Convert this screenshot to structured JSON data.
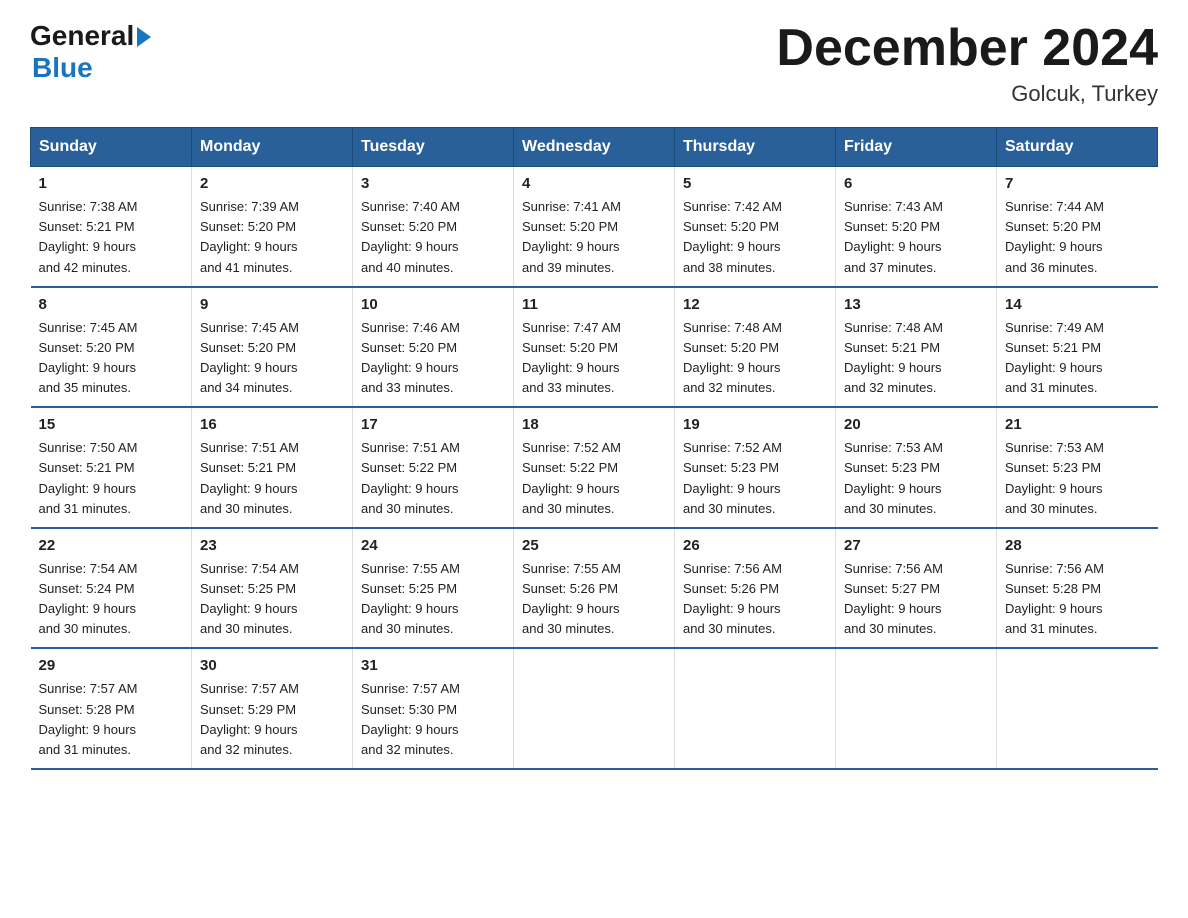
{
  "logo": {
    "general": "General",
    "blue": "Blue"
  },
  "title": "December 2024",
  "location": "Golcuk, Turkey",
  "weekdays": [
    "Sunday",
    "Monday",
    "Tuesday",
    "Wednesday",
    "Thursday",
    "Friday",
    "Saturday"
  ],
  "weeks": [
    [
      {
        "day": "1",
        "sunrise": "7:38 AM",
        "sunset": "5:21 PM",
        "daylight": "9 hours and 42 minutes."
      },
      {
        "day": "2",
        "sunrise": "7:39 AM",
        "sunset": "5:20 PM",
        "daylight": "9 hours and 41 minutes."
      },
      {
        "day": "3",
        "sunrise": "7:40 AM",
        "sunset": "5:20 PM",
        "daylight": "9 hours and 40 minutes."
      },
      {
        "day": "4",
        "sunrise": "7:41 AM",
        "sunset": "5:20 PM",
        "daylight": "9 hours and 39 minutes."
      },
      {
        "day": "5",
        "sunrise": "7:42 AM",
        "sunset": "5:20 PM",
        "daylight": "9 hours and 38 minutes."
      },
      {
        "day": "6",
        "sunrise": "7:43 AM",
        "sunset": "5:20 PM",
        "daylight": "9 hours and 37 minutes."
      },
      {
        "day": "7",
        "sunrise": "7:44 AM",
        "sunset": "5:20 PM",
        "daylight": "9 hours and 36 minutes."
      }
    ],
    [
      {
        "day": "8",
        "sunrise": "7:45 AM",
        "sunset": "5:20 PM",
        "daylight": "9 hours and 35 minutes."
      },
      {
        "day": "9",
        "sunrise": "7:45 AM",
        "sunset": "5:20 PM",
        "daylight": "9 hours and 34 minutes."
      },
      {
        "day": "10",
        "sunrise": "7:46 AM",
        "sunset": "5:20 PM",
        "daylight": "9 hours and 33 minutes."
      },
      {
        "day": "11",
        "sunrise": "7:47 AM",
        "sunset": "5:20 PM",
        "daylight": "9 hours and 33 minutes."
      },
      {
        "day": "12",
        "sunrise": "7:48 AM",
        "sunset": "5:20 PM",
        "daylight": "9 hours and 32 minutes."
      },
      {
        "day": "13",
        "sunrise": "7:48 AM",
        "sunset": "5:21 PM",
        "daylight": "9 hours and 32 minutes."
      },
      {
        "day": "14",
        "sunrise": "7:49 AM",
        "sunset": "5:21 PM",
        "daylight": "9 hours and 31 minutes."
      }
    ],
    [
      {
        "day": "15",
        "sunrise": "7:50 AM",
        "sunset": "5:21 PM",
        "daylight": "9 hours and 31 minutes."
      },
      {
        "day": "16",
        "sunrise": "7:51 AM",
        "sunset": "5:21 PM",
        "daylight": "9 hours and 30 minutes."
      },
      {
        "day": "17",
        "sunrise": "7:51 AM",
        "sunset": "5:22 PM",
        "daylight": "9 hours and 30 minutes."
      },
      {
        "day": "18",
        "sunrise": "7:52 AM",
        "sunset": "5:22 PM",
        "daylight": "9 hours and 30 minutes."
      },
      {
        "day": "19",
        "sunrise": "7:52 AM",
        "sunset": "5:23 PM",
        "daylight": "9 hours and 30 minutes."
      },
      {
        "day": "20",
        "sunrise": "7:53 AM",
        "sunset": "5:23 PM",
        "daylight": "9 hours and 30 minutes."
      },
      {
        "day": "21",
        "sunrise": "7:53 AM",
        "sunset": "5:23 PM",
        "daylight": "9 hours and 30 minutes."
      }
    ],
    [
      {
        "day": "22",
        "sunrise": "7:54 AM",
        "sunset": "5:24 PM",
        "daylight": "9 hours and 30 minutes."
      },
      {
        "day": "23",
        "sunrise": "7:54 AM",
        "sunset": "5:25 PM",
        "daylight": "9 hours and 30 minutes."
      },
      {
        "day": "24",
        "sunrise": "7:55 AM",
        "sunset": "5:25 PM",
        "daylight": "9 hours and 30 minutes."
      },
      {
        "day": "25",
        "sunrise": "7:55 AM",
        "sunset": "5:26 PM",
        "daylight": "9 hours and 30 minutes."
      },
      {
        "day": "26",
        "sunrise": "7:56 AM",
        "sunset": "5:26 PM",
        "daylight": "9 hours and 30 minutes."
      },
      {
        "day": "27",
        "sunrise": "7:56 AM",
        "sunset": "5:27 PM",
        "daylight": "9 hours and 30 minutes."
      },
      {
        "day": "28",
        "sunrise": "7:56 AM",
        "sunset": "5:28 PM",
        "daylight": "9 hours and 31 minutes."
      }
    ],
    [
      {
        "day": "29",
        "sunrise": "7:57 AM",
        "sunset": "5:28 PM",
        "daylight": "9 hours and 31 minutes."
      },
      {
        "day": "30",
        "sunrise": "7:57 AM",
        "sunset": "5:29 PM",
        "daylight": "9 hours and 32 minutes."
      },
      {
        "day": "31",
        "sunrise": "7:57 AM",
        "sunset": "5:30 PM",
        "daylight": "9 hours and 32 minutes."
      },
      null,
      null,
      null,
      null
    ]
  ],
  "labels": {
    "sunrise": "Sunrise:",
    "sunset": "Sunset:",
    "daylight": "Daylight:"
  }
}
